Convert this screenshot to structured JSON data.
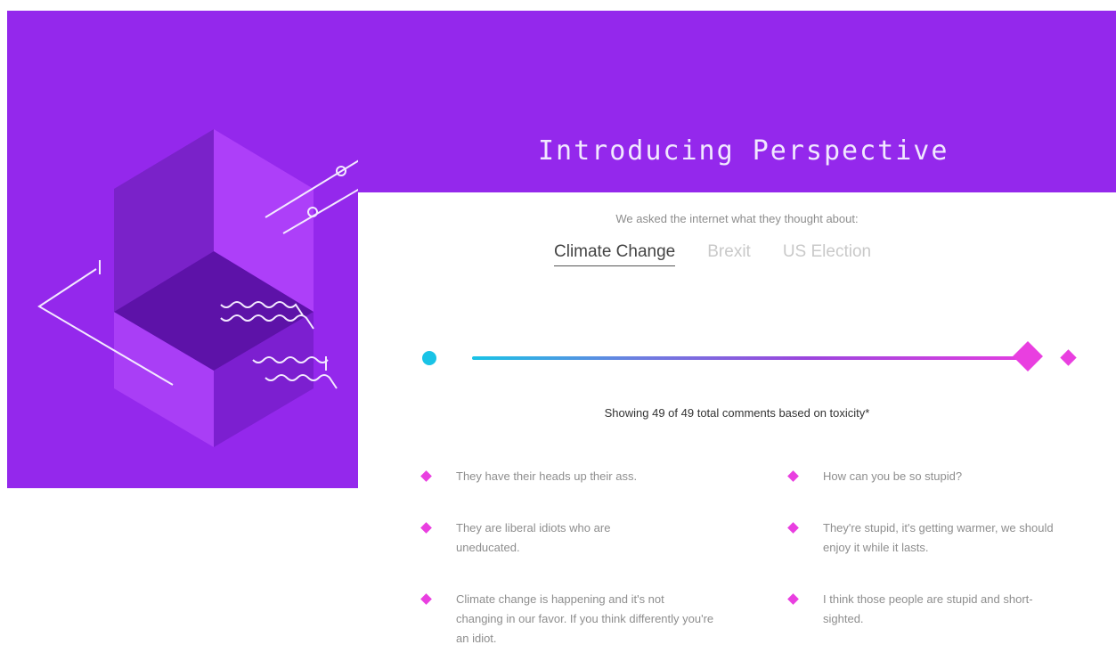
{
  "title": "Introducing Perspective",
  "intro": "We asked the internet what they thought about:",
  "topics": [
    {
      "label": "Climate Change",
      "active": true
    },
    {
      "label": "Brexit",
      "active": false
    },
    {
      "label": "US Election",
      "active": false
    }
  ],
  "slider": {
    "value_fraction": 0.98,
    "start_color": "#19c3e6",
    "end_color": "#e93fe0"
  },
  "summary": "Showing 49 of 49 total comments based on toxicity*",
  "comments_left": [
    "They have their heads up their ass.",
    "They are liberal idiots who are uneducated.",
    "Climate change is happening and it's not changing in our favor. If you think differently you're an idiot."
  ],
  "comments_right": [
    "How can you be so stupid?",
    "They're stupid, it's getting warmer, we should enjoy it while it lasts.",
    "I think those people are stupid and short-sighted."
  ],
  "colors": {
    "brand_purple": "#9428ec",
    "accent_pink": "#e93fe0",
    "accent_cyan": "#19c3e6"
  },
  "icons": {
    "bullet": "diamond-icon",
    "hero": "isometric-box-illustration"
  }
}
